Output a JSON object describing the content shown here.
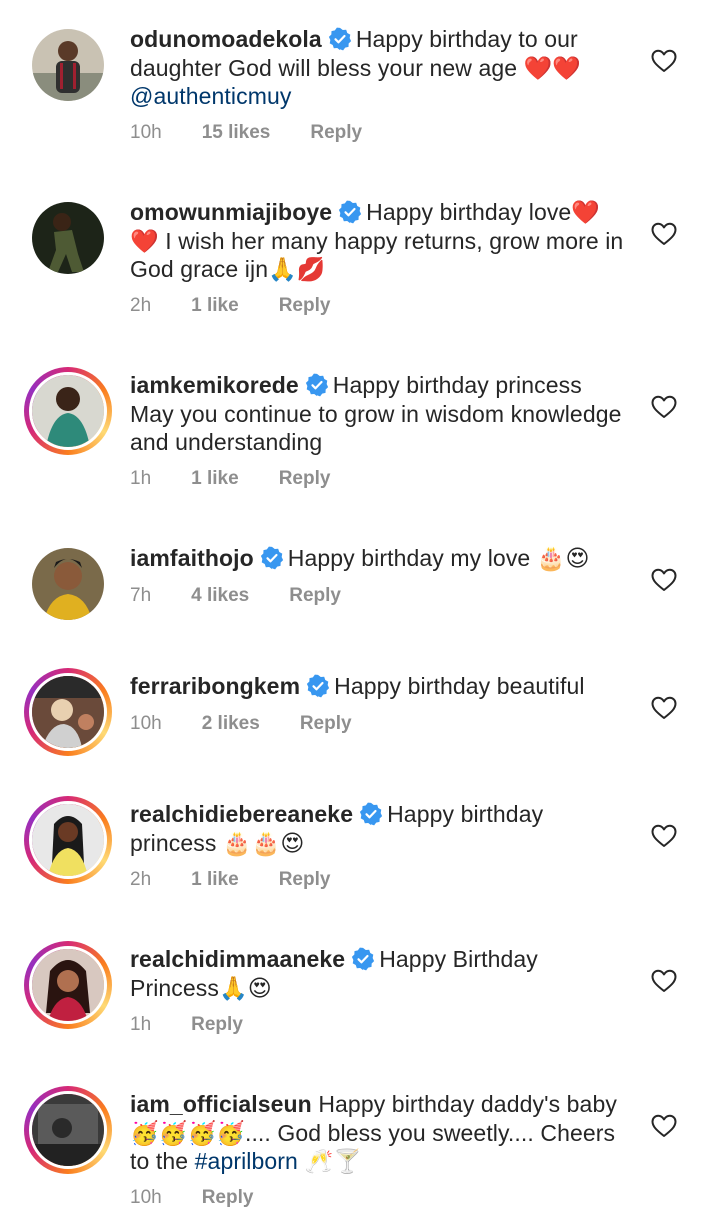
{
  "comments": [
    {
      "username": "odunomoadekola",
      "verified": true,
      "text": "Happy birthday to our daughter God will bless your new age ❤️❤️",
      "mention": "@authenticmuy",
      "time": "10h",
      "likes": "15 likes",
      "reply": "Reply"
    },
    {
      "username": "omowunmiajiboye",
      "verified": true,
      "text": "Happy birthday love❤️ ❤️ I wish her many happy returns, grow more in God grace ijn🙏💋",
      "time": "2h",
      "likes": "1 like",
      "reply": "Reply"
    },
    {
      "username": "iamkemikorede",
      "verified": true,
      "text": "Happy birthday princess May you continue to grow in wisdom knowledge and understanding",
      "time": "1h",
      "likes": "1 like",
      "reply": "Reply"
    },
    {
      "username": "iamfaithojo",
      "verified": true,
      "text": "Happy birthday my love 🎂😍",
      "time": "7h",
      "likes": "4 likes",
      "reply": "Reply"
    },
    {
      "username": "ferraribongkem",
      "verified": true,
      "text": "Happy birthday beautiful",
      "time": "10h",
      "likes": "2 likes",
      "reply": "Reply"
    },
    {
      "username": "realchidiebereaneke",
      "verified": true,
      "text": "Happy birthday princess 🎂🎂😍",
      "time": "2h",
      "likes": "1 like",
      "reply": "Reply"
    },
    {
      "username": "realchidimmaaneke",
      "verified": true,
      "text": "Happy Birthday Princess🙏😍",
      "time": "1h",
      "likes": "",
      "reply": "Reply"
    },
    {
      "username": "iam_officialseun",
      "verified": false,
      "text": "Happy birthday daddy's baby 🥳🥳🥳🥳.... God bless you sweetly.... Cheers to the",
      "hashtag": "#aprilborn",
      "text_after": "🥂🍸",
      "time": "10h",
      "likes": "",
      "reply": "Reply"
    }
  ],
  "colors": {
    "text": "#262626",
    "meta": "#8e8e8e",
    "link": "#00376b",
    "verified": "#3897f0"
  },
  "icons": {
    "verified": "verified-badge-icon",
    "like": "heart-outline-icon"
  }
}
